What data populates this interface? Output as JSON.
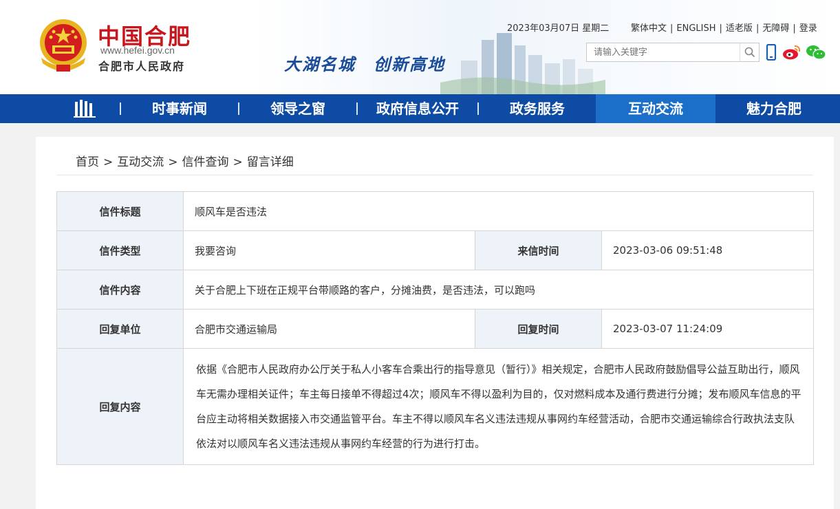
{
  "header": {
    "site_name": "中国合肥",
    "site_url": "www.hefei.gov.cn",
    "site_gov": "合肥市人民政府",
    "slogan": "大湖名城　创新高地",
    "date": "2023年03月07日 星期二",
    "links": [
      "繁体中文",
      "ENGLISH",
      "适老版",
      "无障碍",
      "登录"
    ],
    "search_placeholder": "请输入关键字",
    "social": [
      "mobile-icon",
      "weibo-icon",
      "wechat-icon"
    ]
  },
  "nav": {
    "items": [
      "时事新闻",
      "领导之窗",
      "政府信息公开",
      "政务服务",
      "互动交流",
      "魅力合肥"
    ],
    "active": "互动交流"
  },
  "breadcrumb": [
    "首页",
    "互动交流",
    "信件查询",
    "留言详细"
  ],
  "detail": {
    "title_label": "信件标题",
    "title_value": "顺风车是否违法",
    "type_label": "信件类型",
    "type_value": "我要咨询",
    "sent_label": "来信时间",
    "sent_value": "2023-03-06 09:51:48",
    "content_label": "信件内容",
    "content_value": "关于合肥上下班在正规平台带顺路的客户，分摊油费，是否违法，可以跑吗",
    "unit_label": "回复单位",
    "unit_value": "合肥市交通运输局",
    "reply_time_label": "回复时间",
    "reply_time_value": "2023-03-07 11:24:09",
    "reply_label": "回复内容",
    "reply_value": "依据《合肥市人民政府办公厅关于私人小客车合乘出行的指导意见（暂行）》相关规定，合肥市人民政府鼓励倡导公益互助出行，顺风车无需办理相关证件；车主每日接单不得超过4次；顺风车不得以盈利为目的，仅对燃料成本及通行费进行分摊；发布顺风车信息的平台应主动将相关数据接入市交通监管平台。车主不得以顺风车名义违法违规从事网约车经营活动，合肥市交通运输综合行政执法支队依法对以顺风车名义违法违规从事网约车经营的行为进行打击。"
  },
  "colors": {
    "nav_bg": "#0d4ba4",
    "nav_active": "#1b6fc8",
    "brand_red": "#c8161d",
    "label_blue": "#1a4c9a",
    "label_bg": "#eef2f9"
  }
}
